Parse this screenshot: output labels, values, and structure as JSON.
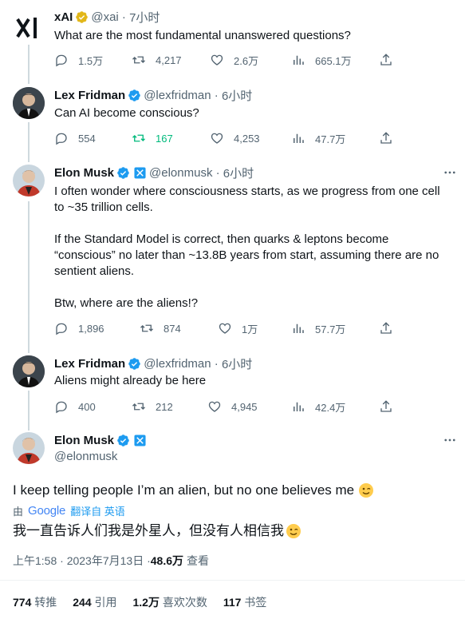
{
  "tweets": [
    {
      "name": "xAI",
      "handle": "@xai",
      "time": "7小时",
      "text": "What are the most fundamental unanswered questions?",
      "reply": "1.5万",
      "retweet": "4,217",
      "like": "2.6万",
      "views": "665.1万"
    },
    {
      "name": "Lex Fridman",
      "handle": "@lexfridman",
      "time": "6小时",
      "text": "Can AI become conscious?",
      "reply": "554",
      "retweet": "167",
      "like": "4,253",
      "views": "47.7万"
    },
    {
      "name": "Elon Musk",
      "handle": "@elonmusk",
      "time": "6小时",
      "text_lines": [
        "I often wonder where consciousness starts, as we progress from one cell",
        "to ~35 trillion cells.",
        "If the Standard Model is correct, then quarks & leptons become",
        "“conscious” no later than ~13.8B years from start, assuming there are no",
        "sentient aliens.",
        "Btw, where are the aliens!?"
      ],
      "reply": "1,896",
      "retweet": "874",
      "like": "1万",
      "views": "57.7万"
    },
    {
      "name": "Lex Fridman",
      "handle": "@lexfridman",
      "time": "6小时",
      "text": "Aliens might already be here",
      "reply": "400",
      "retweet": "212",
      "like": "4,945",
      "views": "42.4万"
    }
  ],
  "main": {
    "name": "Elon Musk",
    "handle": "@elonmusk",
    "text": "I keep telling people I’m an alien, but no one believes me",
    "translate_by": "由",
    "translate_brand": "Google",
    "translate_label": "翻译自 英语",
    "translated": "我一直告诉人们我是外星人，但没有人相信我",
    "datetime": "上午1:58 · 2023年7月13日 · ",
    "views_count": "48.6万",
    "views_label": "查看",
    "stats": [
      {
        "count": "774",
        "label": "转推"
      },
      {
        "count": "244",
        "label": "引用"
      },
      {
        "count": "1.2万",
        "label": "喜欢次数"
      },
      {
        "count": "117",
        "label": "书签"
      }
    ]
  },
  "colors": {
    "blue": "#1d9bf0",
    "gray": "#536471",
    "green": "#00ba7c",
    "gold": "#e2b719"
  }
}
